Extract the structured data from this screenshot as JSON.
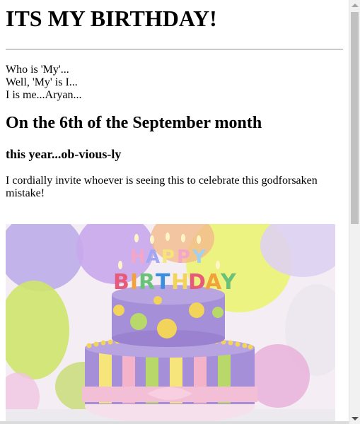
{
  "heading": "ITS MY BIRTHDAY!",
  "intro_lines": [
    "Who is 'My'...",
    "Well, 'My' is I...",
    "I is me...Aryan..."
  ],
  "date_heading": "On the 6th of the September month",
  "subheading": "this year...ob-vious-ly",
  "invite_text": "I cordially invite whoever is seeing this to celebrate this godforsaken mistake!",
  "image": {
    "candle_letters": [
      "HAPPY",
      "BIRTHDAY"
    ]
  }
}
